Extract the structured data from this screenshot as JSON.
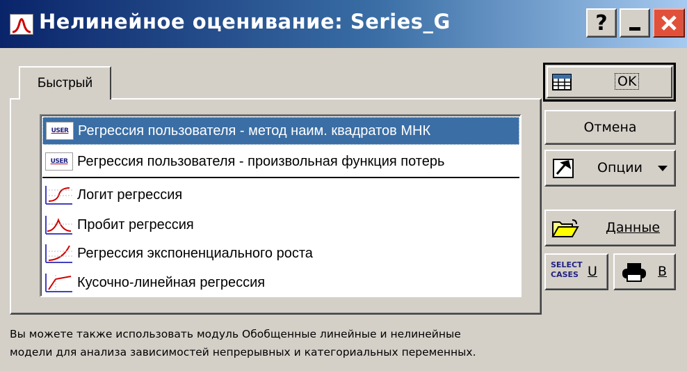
{
  "window": {
    "title": "Нелинейное оценивание: Series_G",
    "controls": {
      "help": "?",
      "minimize": "_",
      "close": "X"
    }
  },
  "tabs": [
    {
      "label": "Быстрый",
      "active": true
    }
  ],
  "methods": [
    {
      "label": "Регрессия пользователя - метод наим. квадратов МНК",
      "icon": "user-regression-icon",
      "icon_text": "USER",
      "selected": true
    },
    {
      "label": "Регрессия пользователя - произвольная функция потерь",
      "icon": "user-regression-icon",
      "icon_text": "USER",
      "selected": false
    },
    {
      "label": "Логит регрессия",
      "icon": "logit-graph-icon",
      "selected": false
    },
    {
      "label": "Пробит регрессия",
      "icon": "probit-graph-icon",
      "selected": false
    },
    {
      "label": "Регрессия экспоненциального роста",
      "icon": "exponential-graph-icon",
      "selected": false
    },
    {
      "label": "Кусочно-линейная регрессия",
      "icon": "piecewise-graph-icon",
      "selected": false
    }
  ],
  "buttons": {
    "ok": "OK",
    "cancel": "Отмена",
    "options": "Опции",
    "data": "Данные",
    "select_cases_text": "SELECT CASES",
    "select_cases_key": "U",
    "print_key": "B"
  },
  "footer": {
    "line1": "Вы можете также использовать модуль Обобщенные линейные и нелинейные",
    "line2": "модели для анализа зависимостей непрерывных и категориальных переменных."
  },
  "colors": {
    "titlebar_start": "#0a246a",
    "titlebar_end": "#a6caf0",
    "selection": "#3a6ea5",
    "face": "#d4d0c8",
    "close_button": "#e0503a"
  }
}
